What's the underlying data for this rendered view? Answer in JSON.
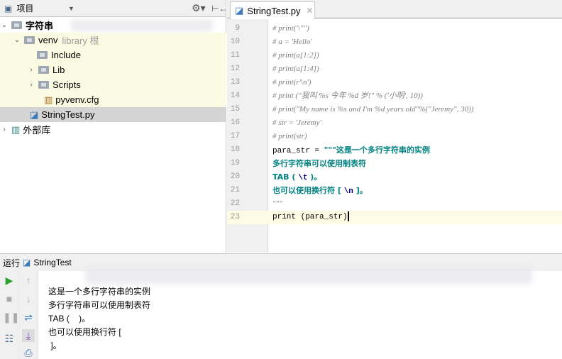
{
  "project_panel": {
    "title": "项目",
    "tree": [
      {
        "label": "字符串",
        "bold": true
      },
      {
        "label": "venv",
        "hint": "library 根"
      },
      {
        "label": "Include"
      },
      {
        "label": "Lib"
      },
      {
        "label": "Scripts"
      },
      {
        "label": "pyvenv.cfg"
      },
      {
        "label": "StringTest.py"
      },
      {
        "label": "外部库"
      }
    ]
  },
  "editor": {
    "tab": "StringTest.py",
    "lines": [
      {
        "n": "9",
        "t": "# print('\\'''')"
      },
      {
        "n": "10",
        "t": "# a = 'Hello'"
      },
      {
        "n": "11",
        "t": "# print(a[1:2])"
      },
      {
        "n": "12",
        "t": "# print(a[1:4])"
      },
      {
        "n": "13",
        "t": "# print(r'\\n')"
      },
      {
        "n": "14",
        "t": "# print (\"我叫 %s 今年 %d 岁!\" % ('小明', 10))"
      },
      {
        "n": "15",
        "t": "# print(\"My name is %s and I'm %d years old\"%(\"Jeremy\", 30))"
      },
      {
        "n": "16",
        "t": "# str = 'Jeremy'"
      },
      {
        "n": "17",
        "t": "# print(str)"
      },
      {
        "n": "18",
        "a": "para_str = ",
        "b": "\"\"\"这是一个多行字符串的实例"
      },
      {
        "n": "19",
        "b": "多行字符串可以使用制表符"
      },
      {
        "n": "20",
        "b": "TAB ( ",
        "e": "\\t",
        "c": " )。"
      },
      {
        "n": "21",
        "b": "也可以使用换行符 [ ",
        "e": "\\n",
        "c": " ]。"
      },
      {
        "n": "22",
        "t": "\"\"\""
      },
      {
        "n": "23",
        "a": "print (para_str)"
      }
    ]
  },
  "run_panel": {
    "label": "运行",
    "config": "StringTest",
    "output": [
      "这是一个多行字符串的实例",
      "多行字符串可以使用制表符",
      "TAB (    )。",
      "也可以使用换行符 [",
      " ]。"
    ]
  }
}
